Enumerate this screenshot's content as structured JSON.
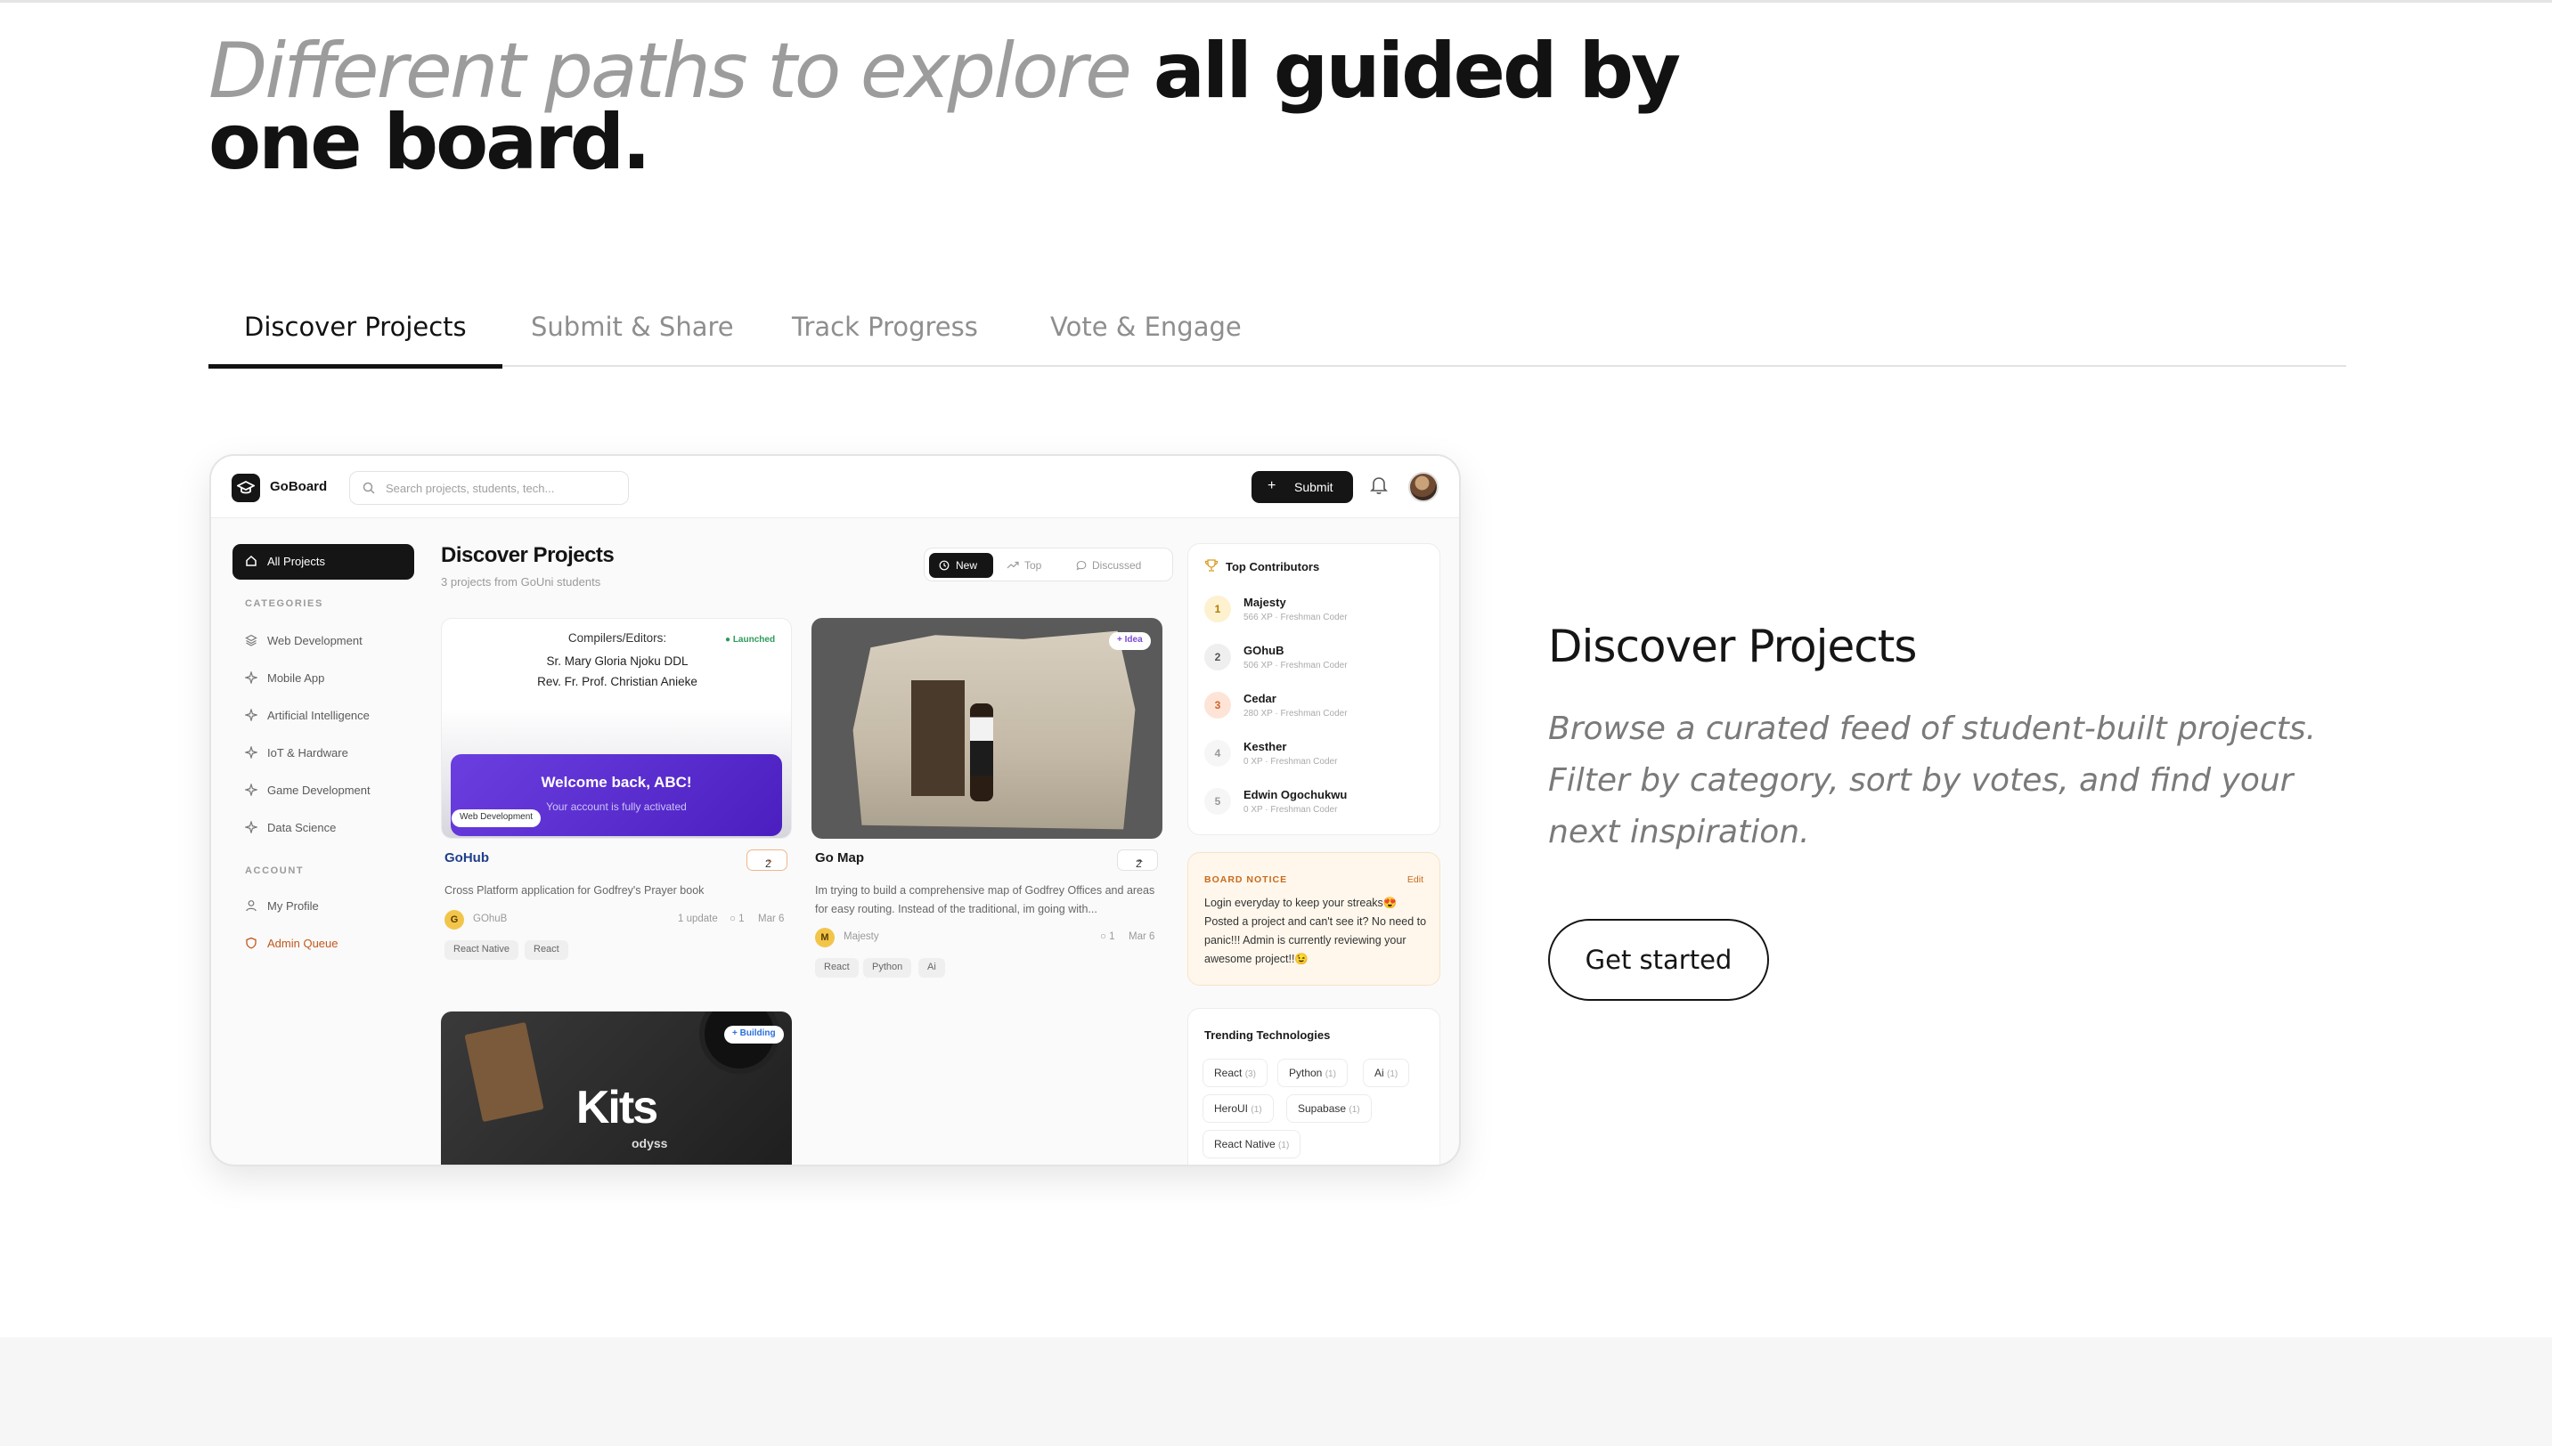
{
  "headline": {
    "muted": "Different paths to explore",
    "strong": "all guided by one board."
  },
  "tabs": [
    {
      "label": "Discover Projects"
    },
    {
      "label": "Submit & Share"
    },
    {
      "label": "Track Progress"
    },
    {
      "label": "Vote & Engage"
    }
  ],
  "preview": {
    "brand": "GoBoard",
    "search_placeholder": "Search projects, students, tech...",
    "submit_label": "Submit",
    "sidebar": {
      "all_projects": "All Projects",
      "categories_heading": "CATEGORIES",
      "categories": [
        "Web Development",
        "Mobile App",
        "Artificial Intelligence",
        "IoT & Hardware",
        "Game Development",
        "Data Science"
      ],
      "account_heading": "ACCOUNT",
      "account_items": [
        "My Profile",
        "Admin Queue"
      ]
    },
    "feed": {
      "title": "Discover Projects",
      "subtitle": "3 projects from GoUni students",
      "sort": [
        "New",
        "Top",
        "Discussed"
      ]
    },
    "cards": [
      {
        "name": "GoHub",
        "status": "Launched",
        "category": "Web Development",
        "votes": "2",
        "description": "Cross Platform application for Godfrey's Prayer book",
        "author_initial": "G",
        "author": "GOhuB",
        "updates": "1 update",
        "comments": "1",
        "date": "Mar 6",
        "tags": [
          "React Native",
          "React"
        ],
        "thumb_heading": "Compilers/Editors:",
        "thumb_line1": "Sr. Mary Gloria Njoku DDL",
        "thumb_line2": "Rev. Fr. Prof. Christian Anieke",
        "thumb_welcome": "Welcome back, ABC!",
        "thumb_welcome_sub": "Your account is fully activated"
      },
      {
        "name": "Go Map",
        "status": "Idea",
        "votes": "2",
        "description": "Im trying to build a comprehensive map of Godfrey Offices and areas for easy routing. Instead of the traditional, im going with...",
        "author_initial": "M",
        "author": "Majesty",
        "comments": "1",
        "date": "Mar 6",
        "tags": [
          "React",
          "Python",
          "Ai"
        ]
      },
      {
        "status": "Building",
        "thumb_word": "Kits",
        "thumb_sub": "odyss"
      }
    ],
    "contributors": {
      "title": "Top Contributors",
      "items": [
        {
          "rank": "1",
          "name": "Majesty",
          "sub": "566 XP · Freshman Coder"
        },
        {
          "rank": "2",
          "name": "GOhuB",
          "sub": "506 XP · Freshman Coder"
        },
        {
          "rank": "3",
          "name": "Cedar",
          "sub": "280 XP · Freshman Coder"
        },
        {
          "rank": "4",
          "name": "Kesther",
          "sub": "0 XP · Freshman Coder"
        },
        {
          "rank": "5",
          "name": "Edwin Ogochukwu",
          "sub": "0 XP · Freshman Coder"
        }
      ]
    },
    "notice": {
      "title": "BOARD NOTICE",
      "edit": "Edit",
      "body": "Login everyday to keep your streaks😍 Posted a project and can't see it? No need to panic!!! Admin is currently reviewing your awesome project!!😉"
    },
    "trending": {
      "title": "Trending Technologies",
      "items": [
        {
          "name": "React",
          "count": "(3)"
        },
        {
          "name": "Python",
          "count": "(1)"
        },
        {
          "name": "Ai",
          "count": "(1)"
        },
        {
          "name": "HeroUI",
          "count": "(1)"
        },
        {
          "name": "Supabase",
          "count": "(1)"
        },
        {
          "name": "React Native",
          "count": "(1)"
        }
      ]
    }
  },
  "detail": {
    "title": "Discover Projects",
    "body": "Browse a curated feed of student-built projects. Filter by category, sort by votes, and find your next inspiration.",
    "cta": "Get started"
  },
  "colors": {
    "ink": "#141414",
    "muted": "#9c9c9c",
    "admin_accent": "#c2571b",
    "notice_bg": "#fff7ec",
    "launched": "#2d9a5a",
    "idea": "#7b4bd6",
    "building": "#2a6fdc"
  }
}
